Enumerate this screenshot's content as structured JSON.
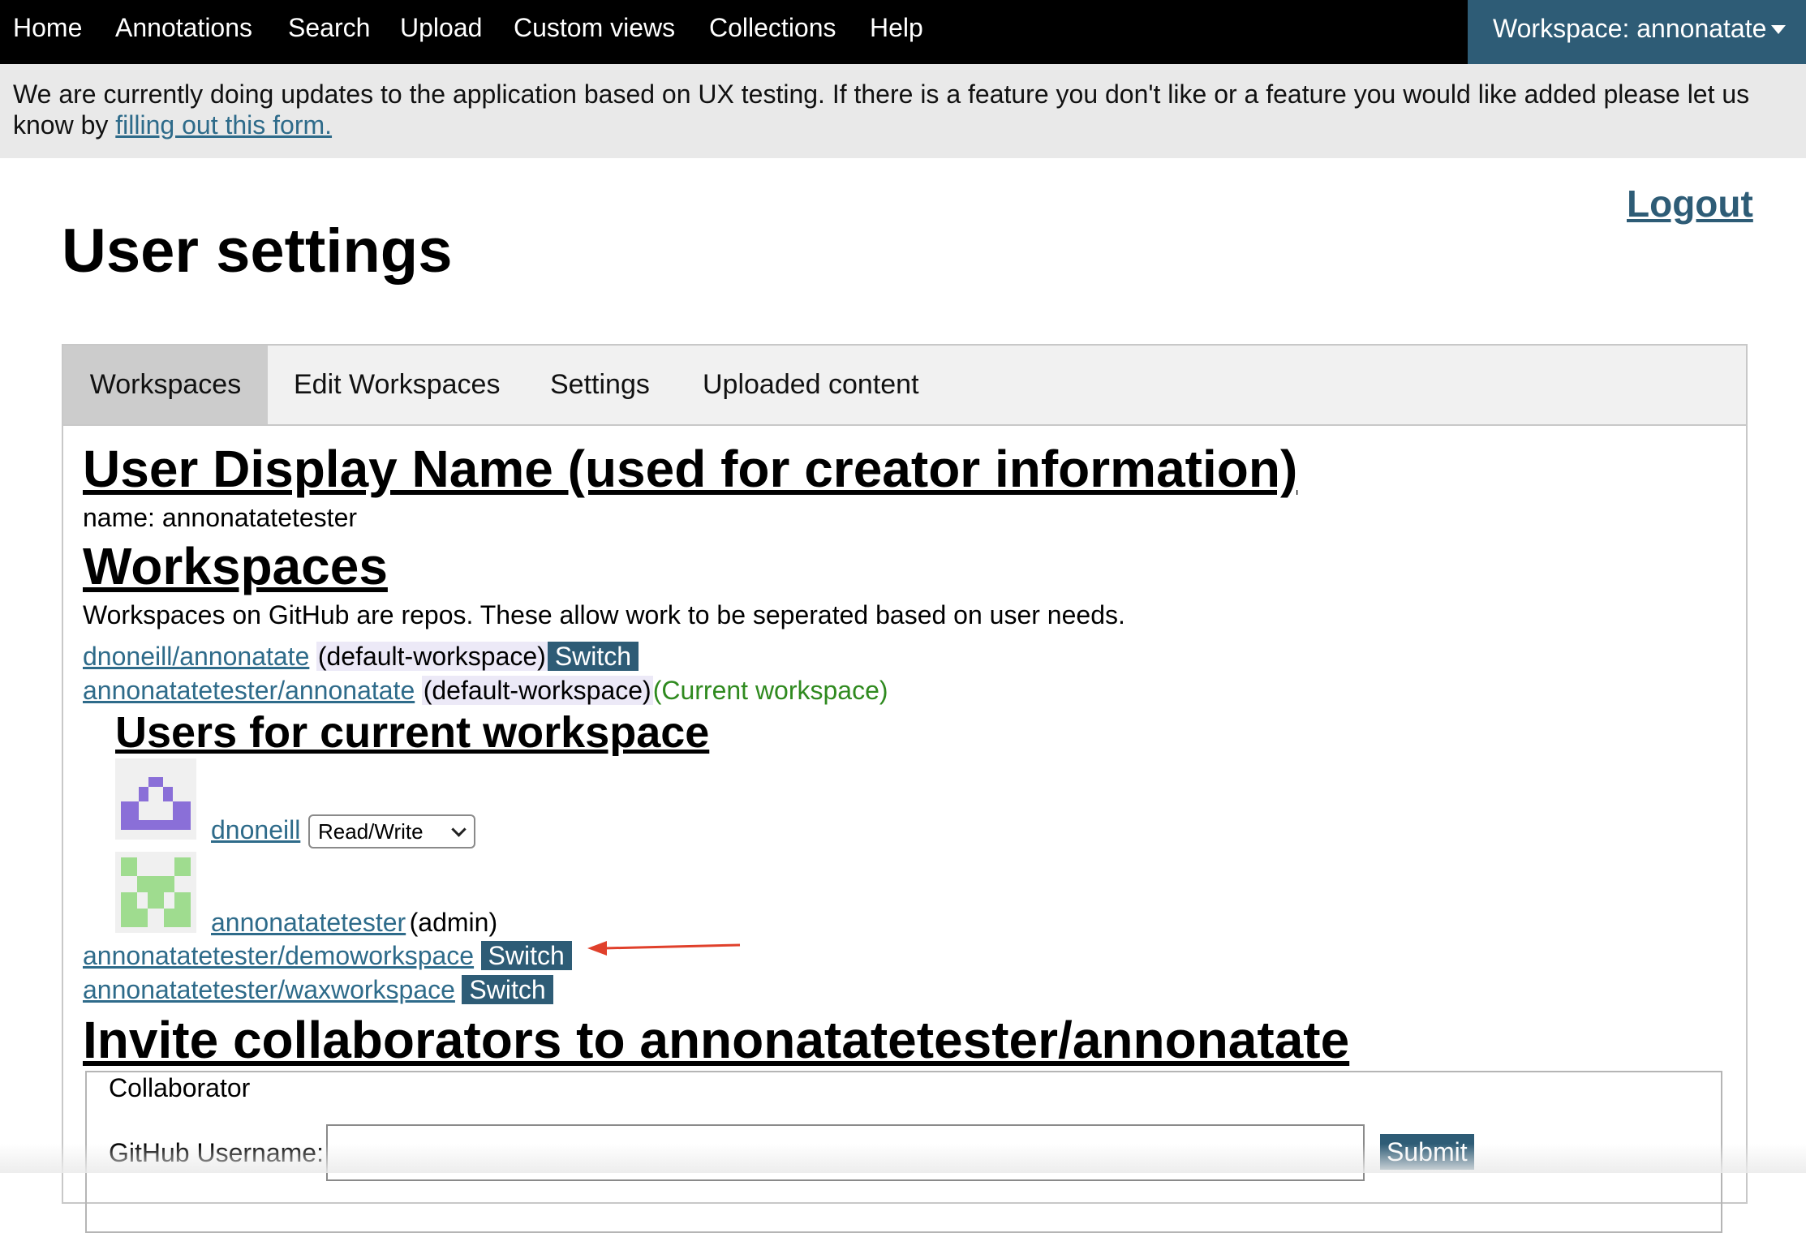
{
  "nav": {
    "items": [
      {
        "label": "Home"
      },
      {
        "label": "Annotations"
      },
      {
        "label": "Search"
      },
      {
        "label": "Upload"
      },
      {
        "label": "Custom views"
      },
      {
        "label": "Collections"
      },
      {
        "label": "Help"
      }
    ],
    "workspace_menu": "Workspace: annonatate",
    "accent_color": "#2e5c76"
  },
  "banner": {
    "text": "We are currently doing updates to the application based on UX testing. If there is a feature you don't like or a feature you would like added please let us know by ",
    "link_text": "filling out this form."
  },
  "header": {
    "logout": "Logout",
    "title": "User settings"
  },
  "tabs": [
    {
      "label": "Workspaces",
      "active": true
    },
    {
      "label": "Edit Workspaces",
      "active": false
    },
    {
      "label": "Settings",
      "active": false
    },
    {
      "label": "Uploaded content",
      "active": false
    }
  ],
  "display_name": {
    "heading": "User Display Name (used for creator information)",
    "value": "name: annonatatetester"
  },
  "workspaces": {
    "heading": "Workspaces",
    "description": "Workspaces on GitHub are repos. These allow work to be seperated based on user needs.",
    "list": [
      {
        "repo": "dnoneill/annonatate",
        "tag": "(default-workspace)",
        "action": "Switch"
      },
      {
        "repo": "annonatatetester/annonatate",
        "tag": "(default-workspace)",
        "current": "(Current workspace)"
      },
      {
        "repo": "annonatatetester/demoworkspace",
        "action": "Switch"
      },
      {
        "repo": "annonatatetester/waxworkspace",
        "action": "Switch"
      }
    ]
  },
  "users": {
    "heading": "Users for current workspace",
    "list": [
      {
        "name": "dnoneill",
        "permission": "Read/Write",
        "avatar_color": "#8a6fd8"
      },
      {
        "name": "annonatatetester",
        "role": "(admin)",
        "avatar_color": "#9fdc8f"
      }
    ]
  },
  "invite": {
    "heading": "Invite collaborators to annonatatetester/annonatate",
    "legend": "Collaborator",
    "field_label": "GitHub Username:",
    "field_value": "",
    "submit": "Submit"
  },
  "annotation_color": "#e0402b"
}
